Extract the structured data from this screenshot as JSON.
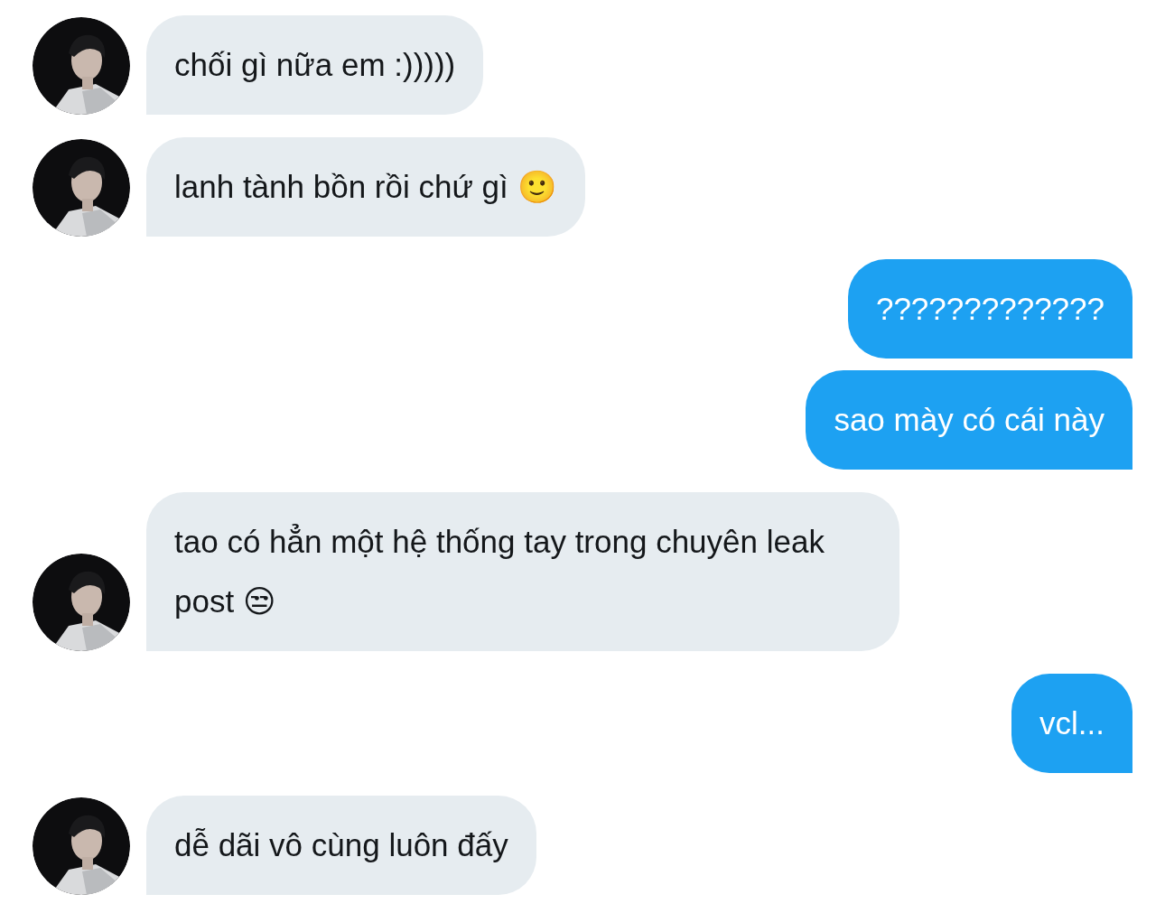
{
  "messages": [
    {
      "kind": "received",
      "text": "chối gì nữa em :)))))"
    },
    {
      "kind": "received",
      "text": "lanh tành bồn rồi chứ gì 🙂"
    },
    {
      "kind": "sent",
      "text": "?????????????"
    },
    {
      "kind": "sent",
      "text": "sao mày có cái này"
    },
    {
      "kind": "received",
      "text": "tao có hẳn một hệ thống tay trong chuyên leak post 😒"
    },
    {
      "kind": "sent",
      "text": "vcl..."
    },
    {
      "kind": "received",
      "text": "dễ dãi vô cùng luôn đấy"
    }
  ]
}
